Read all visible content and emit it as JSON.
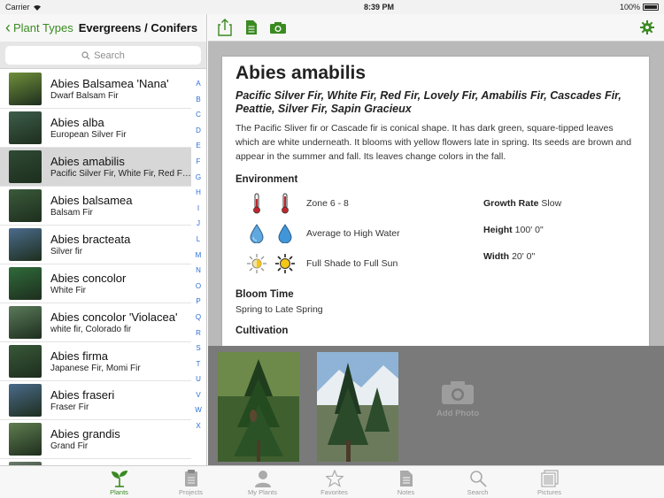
{
  "status": {
    "carrier": "Carrier",
    "time": "8:39 PM",
    "battery": "100%"
  },
  "nav": {
    "back_label": "Plant Types",
    "title": "Evergreens / Conifers"
  },
  "search": {
    "placeholder": "Search"
  },
  "plants": [
    {
      "name": "Abies Balsamea 'Nana'",
      "common": "Dwarf Balsam Fir",
      "thumb_color": "#6f8f3a"
    },
    {
      "name": "Abies alba",
      "common": "European Silver Fir",
      "thumb_color": "#3d5d4a"
    },
    {
      "name": "Abies amabilis",
      "common": "Pacific Silver Fir, White Fir, Red Fir, Lovely Fir, Amabilis Fir",
      "thumb_color": "#2e4a35"
    },
    {
      "name": "Abies balsamea",
      "common": "Balsam Fir",
      "thumb_color": "#3a5a3a"
    },
    {
      "name": "Abies bracteata",
      "common": "Silver fir",
      "thumb_color": "#4a6b8c"
    },
    {
      "name": "Abies concolor",
      "common": "White Fir",
      "thumb_color": "#2f6b3a"
    },
    {
      "name": "Abies concolor 'Violacea'",
      "common": "white fir, Colorado fir",
      "thumb_color": "#5a7a5a"
    },
    {
      "name": "Abies firma",
      "common": "Japanese Fir, Momi Fir",
      "thumb_color": "#385838"
    },
    {
      "name": "Abies fraseri",
      "common": "Fraser Fir",
      "thumb_color": "#4a6a8a"
    },
    {
      "name": "Abies grandis",
      "common": "Grand Fir",
      "thumb_color": "#5f7d4f"
    },
    {
      "name": "",
      "common": "",
      "thumb_color": "#6b7b6b"
    }
  ],
  "alphabet": [
    "A",
    "B",
    "C",
    "D",
    "E",
    "F",
    "G",
    "H",
    "I",
    "J",
    "L",
    "M",
    "N",
    "O",
    "P",
    "Q",
    "R",
    "S",
    "T",
    "U",
    "V",
    "W",
    "X"
  ],
  "detail": {
    "species": "Abies amabilis",
    "synonyms": "Pacific Silver Fir, White Fir, Red Fir, Lovely Fir, Amabilis Fir, Cascades Fir, Peattie, Silver Fir, Sapin Gracieux",
    "description": "The Pacific Sliver fir or Cascade fir is conical shape. It has dark green, square-tipped leaves which are white underneath. It blooms with yellow flowers late in spring. Its seeds are brown and appear in the summer and fall. Its leaves change colors in the fall.",
    "environment_heading": "Environment",
    "zone": "Zone 6 - 8",
    "water": "Average to High Water",
    "sun": "Full Shade to Full Sun",
    "growth_rate_label": "Growth Rate",
    "growth_rate": "Slow",
    "height_label": "Height",
    "height": "100' 0\"",
    "width_label": "Width",
    "width": "20' 0\"",
    "bloom_heading": "Bloom Time",
    "bloom": "Spring to Late Spring",
    "cultivation_heading": "Cultivation"
  },
  "photos": {
    "add_label": "Add Photo"
  },
  "tabs": [
    {
      "label": "Plants",
      "icon": "plant-icon"
    },
    {
      "label": "Projects",
      "icon": "projects-icon"
    },
    {
      "label": "My Plants",
      "icon": "person-icon"
    },
    {
      "label": "Favorites",
      "icon": "star-icon"
    },
    {
      "label": "Notes",
      "icon": "notes-icon"
    },
    {
      "label": "Search",
      "icon": "search-icon"
    },
    {
      "label": "Pictures",
      "icon": "pictures-icon"
    }
  ],
  "colors": {
    "accent": "#3a8a22",
    "index_blue": "#2a6fd8",
    "selected_row": "#d7d7d7"
  }
}
